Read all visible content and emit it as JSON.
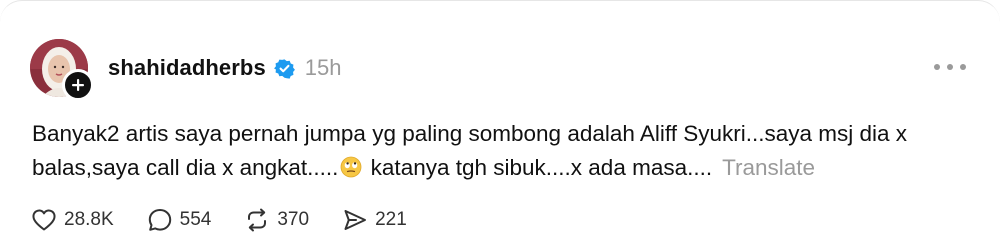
{
  "post": {
    "username": "shahidadherbs",
    "time": "15h",
    "text_before_emoji": "Banyak2 artis saya pernah jumpa yg paling sombong adalah Aliff Syukri...saya msj dia x balas,saya call dia x angkat.....",
    "emoji": "face-with-rolling-eyes",
    "text_after_emoji": " katanya tgh sibuk....x ada masa....",
    "translate_label": "Translate"
  },
  "actions": {
    "likes": "28.8K",
    "replies": "554",
    "reposts": "370",
    "shares": "221"
  },
  "icons": {
    "verified": "verified-badge-icon",
    "follow": "plus-icon",
    "more": "more-dots-icon",
    "like": "heart-icon",
    "reply": "comment-bubble-icon",
    "repost": "repost-icon",
    "share": "send-icon"
  },
  "colors": {
    "verified_blue": "#1d9bf0",
    "muted_gray": "#9a9a9a",
    "text": "#111111"
  }
}
